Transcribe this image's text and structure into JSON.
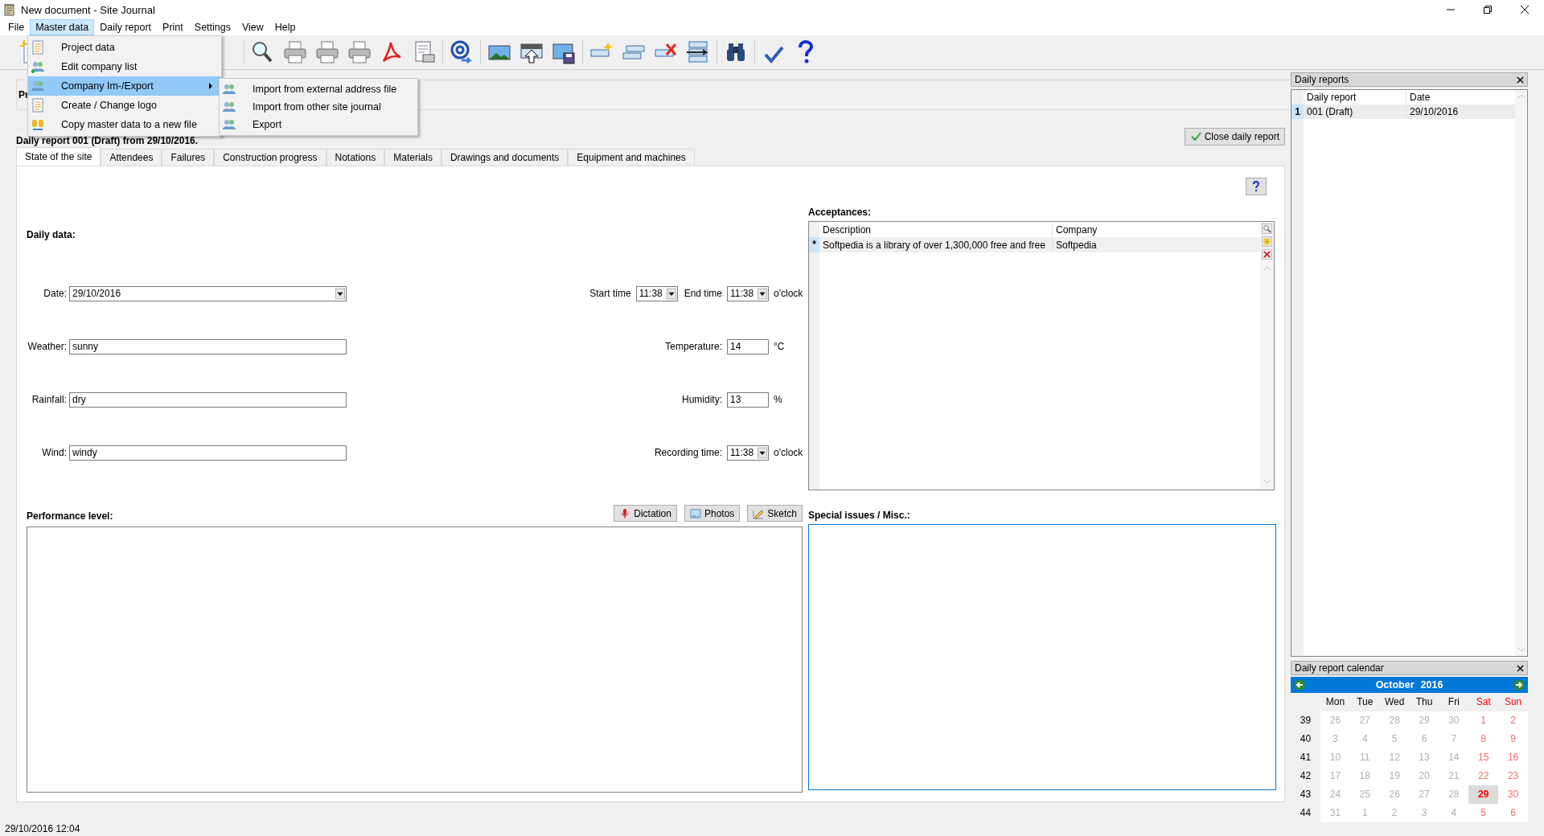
{
  "window": {
    "title": "New document - Site Journal"
  },
  "menu_bar": [
    {
      "label": "File",
      "selected": false
    },
    {
      "label": "Master data",
      "selected": true
    },
    {
      "label": "Daily report",
      "selected": false
    },
    {
      "label": "Print",
      "selected": false
    },
    {
      "label": "Settings",
      "selected": false
    },
    {
      "label": "View",
      "selected": false
    },
    {
      "label": "Help",
      "selected": false
    }
  ],
  "master_data_menu": [
    {
      "label": "Project data",
      "kind": "document",
      "has_submenu": false,
      "selected": false
    },
    {
      "label": "Edit company list",
      "kind": "people-edit",
      "has_submenu": false,
      "selected": false
    },
    {
      "label": "Company Im-/Export",
      "kind": "people",
      "has_submenu": true,
      "selected": true
    },
    {
      "label": "Create / Change logo",
      "kind": "document",
      "has_submenu": false,
      "selected": false
    },
    {
      "label": "Copy master data to a new file",
      "kind": "database",
      "has_submenu": false,
      "selected": false
    }
  ],
  "submenu": [
    {
      "label": "Import from external address file",
      "kind": "people",
      "selected": false
    },
    {
      "label": "Import from other site journal",
      "kind": "people",
      "selected": false
    },
    {
      "label": "Export",
      "kind": "people",
      "selected": false
    }
  ],
  "project_panel": {
    "label": "Pr"
  },
  "report_heading": "Daily report 001 (Draft) from 29/10/2016.",
  "close_report_button": "Close daily report",
  "tabs": [
    {
      "label": "State of the site",
      "selected": true
    },
    {
      "label": "Attendees",
      "selected": false
    },
    {
      "label": "Failures",
      "selected": false
    },
    {
      "label": "Construction progress",
      "selected": false
    },
    {
      "label": "Notations",
      "selected": false
    },
    {
      "label": "Materials",
      "selected": false
    },
    {
      "label": "Drawings and documents",
      "selected": false
    },
    {
      "label": "Equipment and machines",
      "selected": false
    }
  ],
  "daily_data": {
    "title": "Daily data:",
    "rows": [
      {
        "label": "Date:",
        "value": "29/10/2016",
        "kind": "combo",
        "right": [
          {
            "kind": "label",
            "text": "Start time"
          },
          {
            "kind": "combo",
            "text": "11:38"
          },
          {
            "kind": "label",
            "text": "End time"
          },
          {
            "kind": "combo",
            "text": "11:38"
          },
          {
            "kind": "unit",
            "text": "o'clock"
          }
        ]
      },
      {
        "label": "Weather:",
        "value": "sunny",
        "kind": "text",
        "right": [
          {
            "kind": "label",
            "text": "Temperature:"
          },
          {
            "kind": "input",
            "text": "14"
          },
          {
            "kind": "unit",
            "text": "°C"
          }
        ]
      },
      {
        "label": "Rainfall:",
        "value": "dry",
        "kind": "text",
        "right": [
          {
            "kind": "label",
            "text": "Humidity:"
          },
          {
            "kind": "input",
            "text": "13"
          },
          {
            "kind": "unit",
            "text": "%"
          }
        ]
      },
      {
        "label": "Wind:",
        "value": "windy",
        "kind": "text",
        "right": [
          {
            "kind": "label",
            "text": "Recording time:"
          },
          {
            "kind": "combo",
            "text": "11:38"
          },
          {
            "kind": "unit",
            "text": "o'clock"
          }
        ]
      }
    ]
  },
  "performance": {
    "title": "Performance level:",
    "buttons": [
      {
        "label": "Dictation",
        "kind": "microphone"
      },
      {
        "label": "Photos",
        "kind": "image"
      },
      {
        "label": "Sketch",
        "kind": "sketch"
      }
    ]
  },
  "acceptances": {
    "title": "Acceptances:",
    "columns": [
      "Description",
      "Company"
    ],
    "rows": [
      {
        "marker": "*",
        "cells": [
          "Softpedia is a library of over 1,300,000 free and free",
          "Softpedia"
        ]
      }
    ]
  },
  "special_issues": {
    "title": "Special issues / Misc.:"
  },
  "status_bar": "29/10/2016 12:04",
  "daily_reports": {
    "title": "Daily reports",
    "columns": [
      "Daily report",
      "Date"
    ],
    "rows": [
      {
        "number": "1",
        "cells": [
          "001 (Draft)",
          "29/10/2016"
        ],
        "selected": true
      }
    ]
  },
  "calendar": {
    "title": "Daily report calendar",
    "month": "October",
    "year": "2016",
    "weekdays": [
      {
        "label": "Mon",
        "weekend": false
      },
      {
        "label": "Tue",
        "weekend": false
      },
      {
        "label": "Wed",
        "weekend": false
      },
      {
        "label": "Thu",
        "weekend": false
      },
      {
        "label": "Fri",
        "weekend": false
      },
      {
        "label": "Sat",
        "weekend": true
      },
      {
        "label": "Sun",
        "weekend": true
      }
    ],
    "weeks": [
      {
        "number": "39",
        "days": [
          {
            "day": "26",
            "selected": false
          },
          {
            "day": "27",
            "selected": false
          },
          {
            "day": "28",
            "selected": false
          },
          {
            "day": "29",
            "selected": false
          },
          {
            "day": "30",
            "selected": false
          },
          {
            "day": "1",
            "selected": false
          },
          {
            "day": "2",
            "selected": false
          }
        ]
      },
      {
        "number": "40",
        "days": [
          {
            "day": "3",
            "selected": false
          },
          {
            "day": "4",
            "selected": false
          },
          {
            "day": "5",
            "selected": false
          },
          {
            "day": "6",
            "selected": false
          },
          {
            "day": "7",
            "selected": false
          },
          {
            "day": "8",
            "selected": false
          },
          {
            "day": "9",
            "selected": false
          }
        ]
      },
      {
        "number": "41",
        "days": [
          {
            "day": "10",
            "selected": false
          },
          {
            "day": "11",
            "selected": false
          },
          {
            "day": "12",
            "selected": false
          },
          {
            "day": "13",
            "selected": false
          },
          {
            "day": "14",
            "selected": false
          },
          {
            "day": "15",
            "selected": false
          },
          {
            "day": "16",
            "selected": false
          }
        ]
      },
      {
        "number": "42",
        "days": [
          {
            "day": "17",
            "selected": false
          },
          {
            "day": "18",
            "selected": false
          },
          {
            "day": "19",
            "selected": false
          },
          {
            "day": "20",
            "selected": false
          },
          {
            "day": "21",
            "selected": false
          },
          {
            "day": "22",
            "selected": false
          },
          {
            "day": "23",
            "selected": false
          }
        ]
      },
      {
        "number": "43",
        "days": [
          {
            "day": "24",
            "selected": false
          },
          {
            "day": "25",
            "selected": false
          },
          {
            "day": "26",
            "selected": false
          },
          {
            "day": "27",
            "selected": false
          },
          {
            "day": "28",
            "selected": false
          },
          {
            "day": "29",
            "selected": true
          },
          {
            "day": "30",
            "selected": false
          }
        ]
      },
      {
        "number": "44",
        "days": [
          {
            "day": "31",
            "selected": false
          },
          {
            "day": "1",
            "selected": false
          },
          {
            "day": "2",
            "selected": false
          },
          {
            "day": "3",
            "selected": false
          },
          {
            "day": "4",
            "selected": false
          },
          {
            "day": "5",
            "selected": false
          },
          {
            "day": "6",
            "selected": false
          }
        ]
      }
    ]
  }
}
